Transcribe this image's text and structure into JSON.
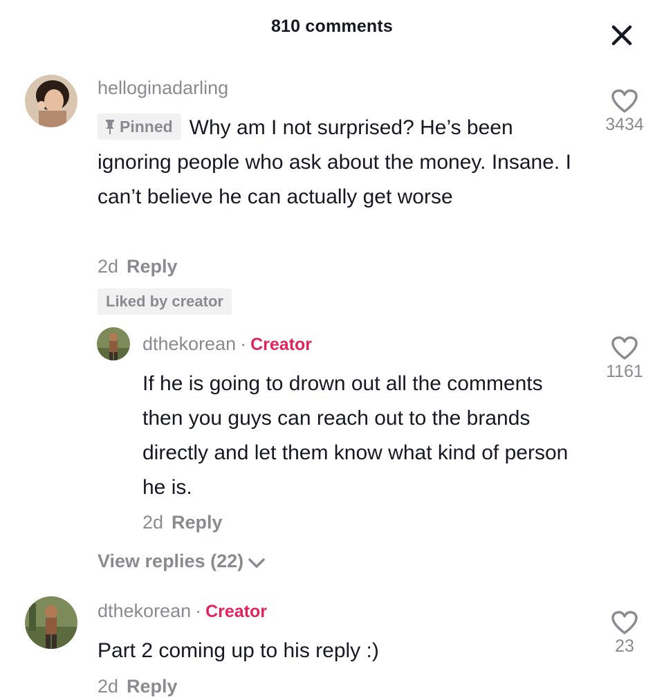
{
  "header": {
    "title": "810 comments"
  },
  "close_icon": "close-icon",
  "comments": [
    {
      "username": "helloginadarling",
      "pinned_label": "Pinned",
      "text": "Why am I not surprised? He’s been ignoring people who ask about the money. Insane. I can’t believe he can actually get worse",
      "age": "2d",
      "reply_label": "Reply",
      "liked_badge": "Liked by creator",
      "likes": "3434",
      "replies": [
        {
          "username": "dthekorean",
          "separator": "·",
          "tag": "Creator",
          "text": "If he is going to drown out all the comments then you guys can reach out to the brands directly and let them know what kind of person he is.",
          "age": "2d",
          "reply_label": "Reply",
          "likes": "1161"
        }
      ],
      "view_replies_label": "View replies (22)"
    },
    {
      "username": "dthekorean",
      "separator": "·",
      "tag": "Creator",
      "text": "Part 2 coming up to his reply :)",
      "age": "2d",
      "reply_label": "Reply",
      "likes": "23"
    }
  ],
  "colors": {
    "creator": "#e0245e",
    "muted": "#8a8b91",
    "text": "#161823",
    "badge_bg": "#f1f1f2"
  }
}
